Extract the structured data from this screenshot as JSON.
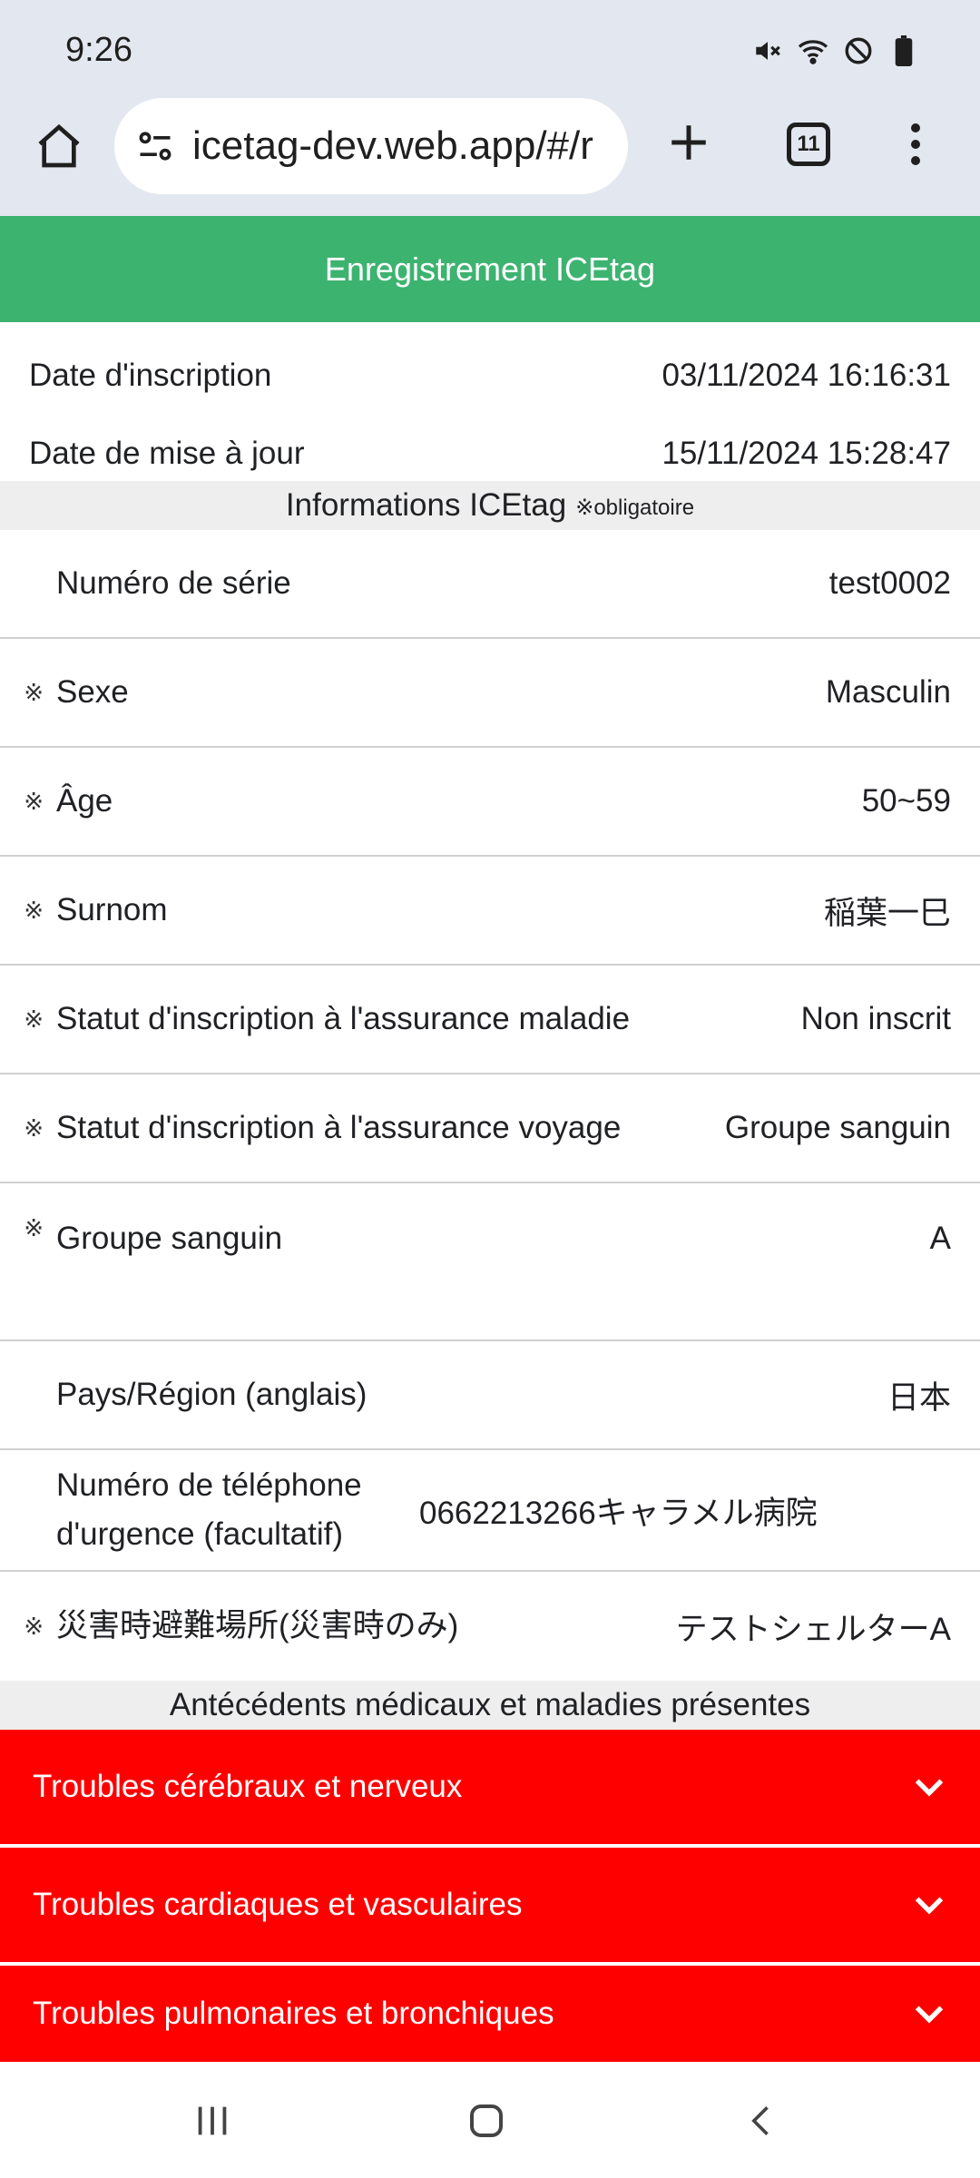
{
  "status": {
    "time": "9:26"
  },
  "browser": {
    "url": "icetag-dev.web.app/#/r",
    "tab_count": "11"
  },
  "header": {
    "title": "Enregistrement ICEtag"
  },
  "dates": [
    {
      "label": "Date d'inscription",
      "value": "03/11/2024 16:16:31"
    },
    {
      "label": "Date de mise à jour",
      "value": "15/11/2024 15:28:47"
    }
  ],
  "section_info": {
    "title": "Informations ICEtag",
    "note": "※obligatoire"
  },
  "fields": [
    {
      "required": "",
      "label": "Numéro de série",
      "value": "test0002"
    },
    {
      "required": "※",
      "label": "Sexe",
      "value": "Masculin"
    },
    {
      "required": "※",
      "label": "Âge",
      "value": "50~59"
    },
    {
      "required": "※",
      "label": "Surnom",
      "value": "稲葉一巳"
    },
    {
      "required": "※",
      "label": "Statut d'inscription à l'assurance maladie",
      "value": "Non inscrit"
    },
    {
      "required": "※",
      "label": "Statut d'inscription à l'assurance voyage",
      "value": "Groupe sanguin"
    },
    {
      "required": "※",
      "label": "Groupe sanguin",
      "value": "A"
    },
    {
      "required": "",
      "label": "Pays/Région (anglais)",
      "value": "日本"
    },
    {
      "required": "",
      "label": "Numéro de téléphone d'urgence (facultatif)",
      "value": "0662213266キャラメル病院"
    },
    {
      "required": "※",
      "label": "災害時避難場所(災害時のみ)",
      "value": "テストシェルターA"
    }
  ],
  "section_medical": {
    "title": "Antécédents médicaux et maladies présentes"
  },
  "accordions": [
    {
      "label": "Troubles cérébraux et nerveux"
    },
    {
      "label": "Troubles cardiaques et vasculaires"
    },
    {
      "label": "Troubles pulmonaires et bronchiques"
    }
  ],
  "colors": {
    "header_green": "#3db370",
    "accordion_red": "#ff0000",
    "chrome_bg": "#e3e8f0"
  }
}
